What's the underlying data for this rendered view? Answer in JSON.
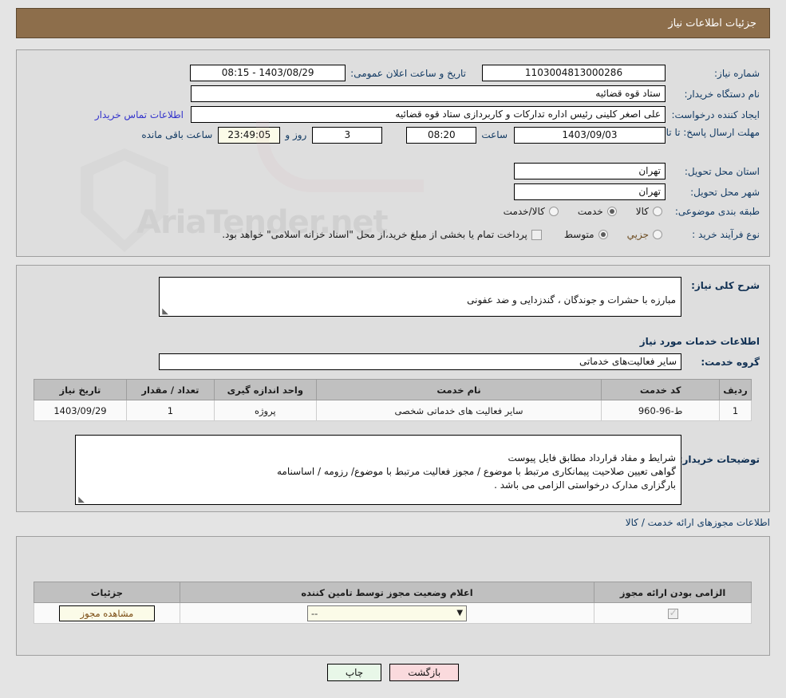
{
  "header": {
    "title": "جزئیات اطلاعات نیاز"
  },
  "form": {
    "need_number": {
      "label": "شماره نیاز:",
      "value": "1103004813000286"
    },
    "announce_datetime": {
      "label": "تاریخ و ساعت اعلان عمومی:",
      "value": "1403/08/29 - 08:15"
    },
    "buyer_org": {
      "label": "نام دستگاه خریدار:",
      "value": "ستاد قوه قضائیه"
    },
    "requester": {
      "label": "ایجاد کننده درخواست:",
      "value": "علی اصغر کلینی رئیس اداره تدارکات و کاربردازی ستاد قوه قضائیه"
    },
    "contact_link": {
      "label": "اطلاعات تماس خریدار"
    },
    "deadline": {
      "label": "مهلت ارسال پاسخ: تا تاریخ:",
      "date": "1403/09/03",
      "hour_label": "ساعت",
      "hour": "08:20",
      "days": "3",
      "days_label": "روز و",
      "countdown": "23:49:05",
      "countdown_label": "ساعت باقی مانده"
    },
    "delivery_province": {
      "label": "استان محل تحویل:",
      "value": "تهران"
    },
    "delivery_city": {
      "label": "شهر محل تحویل:",
      "value": "تهران"
    },
    "subject_category": {
      "label": "طبقه بندی موضوعی:",
      "options": [
        {
          "text": "کالا",
          "selected": false
        },
        {
          "text": "خدمت",
          "selected": true
        },
        {
          "text": "کالا/خدمت",
          "selected": false
        }
      ]
    },
    "purchase_process": {
      "label": "نوع فرآیند خرید :",
      "options": [
        {
          "text": "جزیي",
          "selected": false
        },
        {
          "text": "متوسط",
          "selected": true
        }
      ],
      "treasury_checkbox": {
        "checked": false,
        "text": "پرداخت تمام یا بخشی از مبلغ خرید،از محل \"اسناد خزانه اسلامی\" خواهد بود."
      }
    }
  },
  "need_summary": {
    "label": "شرح کلی نیاز:",
    "value": "مبارزه با حشرات و جوندگان ، گندزدایی و ضد عفونی"
  },
  "services_section": {
    "heading": "اطلاعات خدمات مورد نیاز",
    "service_group": {
      "label": "گروه خدمت:",
      "value": "سایر فعالیت‌های خدماتی"
    },
    "table": {
      "columns": [
        "ردیف",
        "کد خدمت",
        "نام خدمت",
        "واحد اندازه گیری",
        "تعداد / مقدار",
        "تاریخ نیاز"
      ],
      "rows": [
        {
          "row_no": "1",
          "service_code": "ط-96-960",
          "service_name": "سایر فعالیت های خدماتی شخصی",
          "unit": "پروژه",
          "quantity": "1",
          "need_date": "1403/09/29"
        }
      ]
    }
  },
  "buyer_notes": {
    "label": "توضیحات خریدار:",
    "value": "شرایط و مفاد قرارداد مطابق فایل پیوست\nگواهی تعیین صلاحیت پیمانکاری مرتبط با موضوع / مجوز فعالیت مرتبط با موضوع/ رزومه / اساسنامه\nبارگزاری مدارک درخواستی الزامی می باشد ."
  },
  "permits_section": {
    "heading": "اطلاعات مجوزهای ارائه خدمت / کالا",
    "table": {
      "columns": [
        "الزامی بودن ارائه مجوز",
        "اعلام وضعیت مجوز توسط تامین کننده",
        "جزئیات"
      ],
      "rows": [
        {
          "required_checked": true,
          "status_value": "--",
          "details_button": "مشاهده مجوز"
        }
      ]
    }
  },
  "footer": {
    "print_button": "چاپ",
    "back_button": "بازگشت"
  },
  "colors": {
    "header_bg": "#8d6e4b",
    "panel_bg": "#dedede",
    "label_text": "#123a63",
    "link": "#3333cc",
    "table_header_bg": "#c0c0c0",
    "cream_field": "#fbfbe8",
    "print_button_bg": "#e8f7e8",
    "back_button_bg": "#fadadd"
  }
}
